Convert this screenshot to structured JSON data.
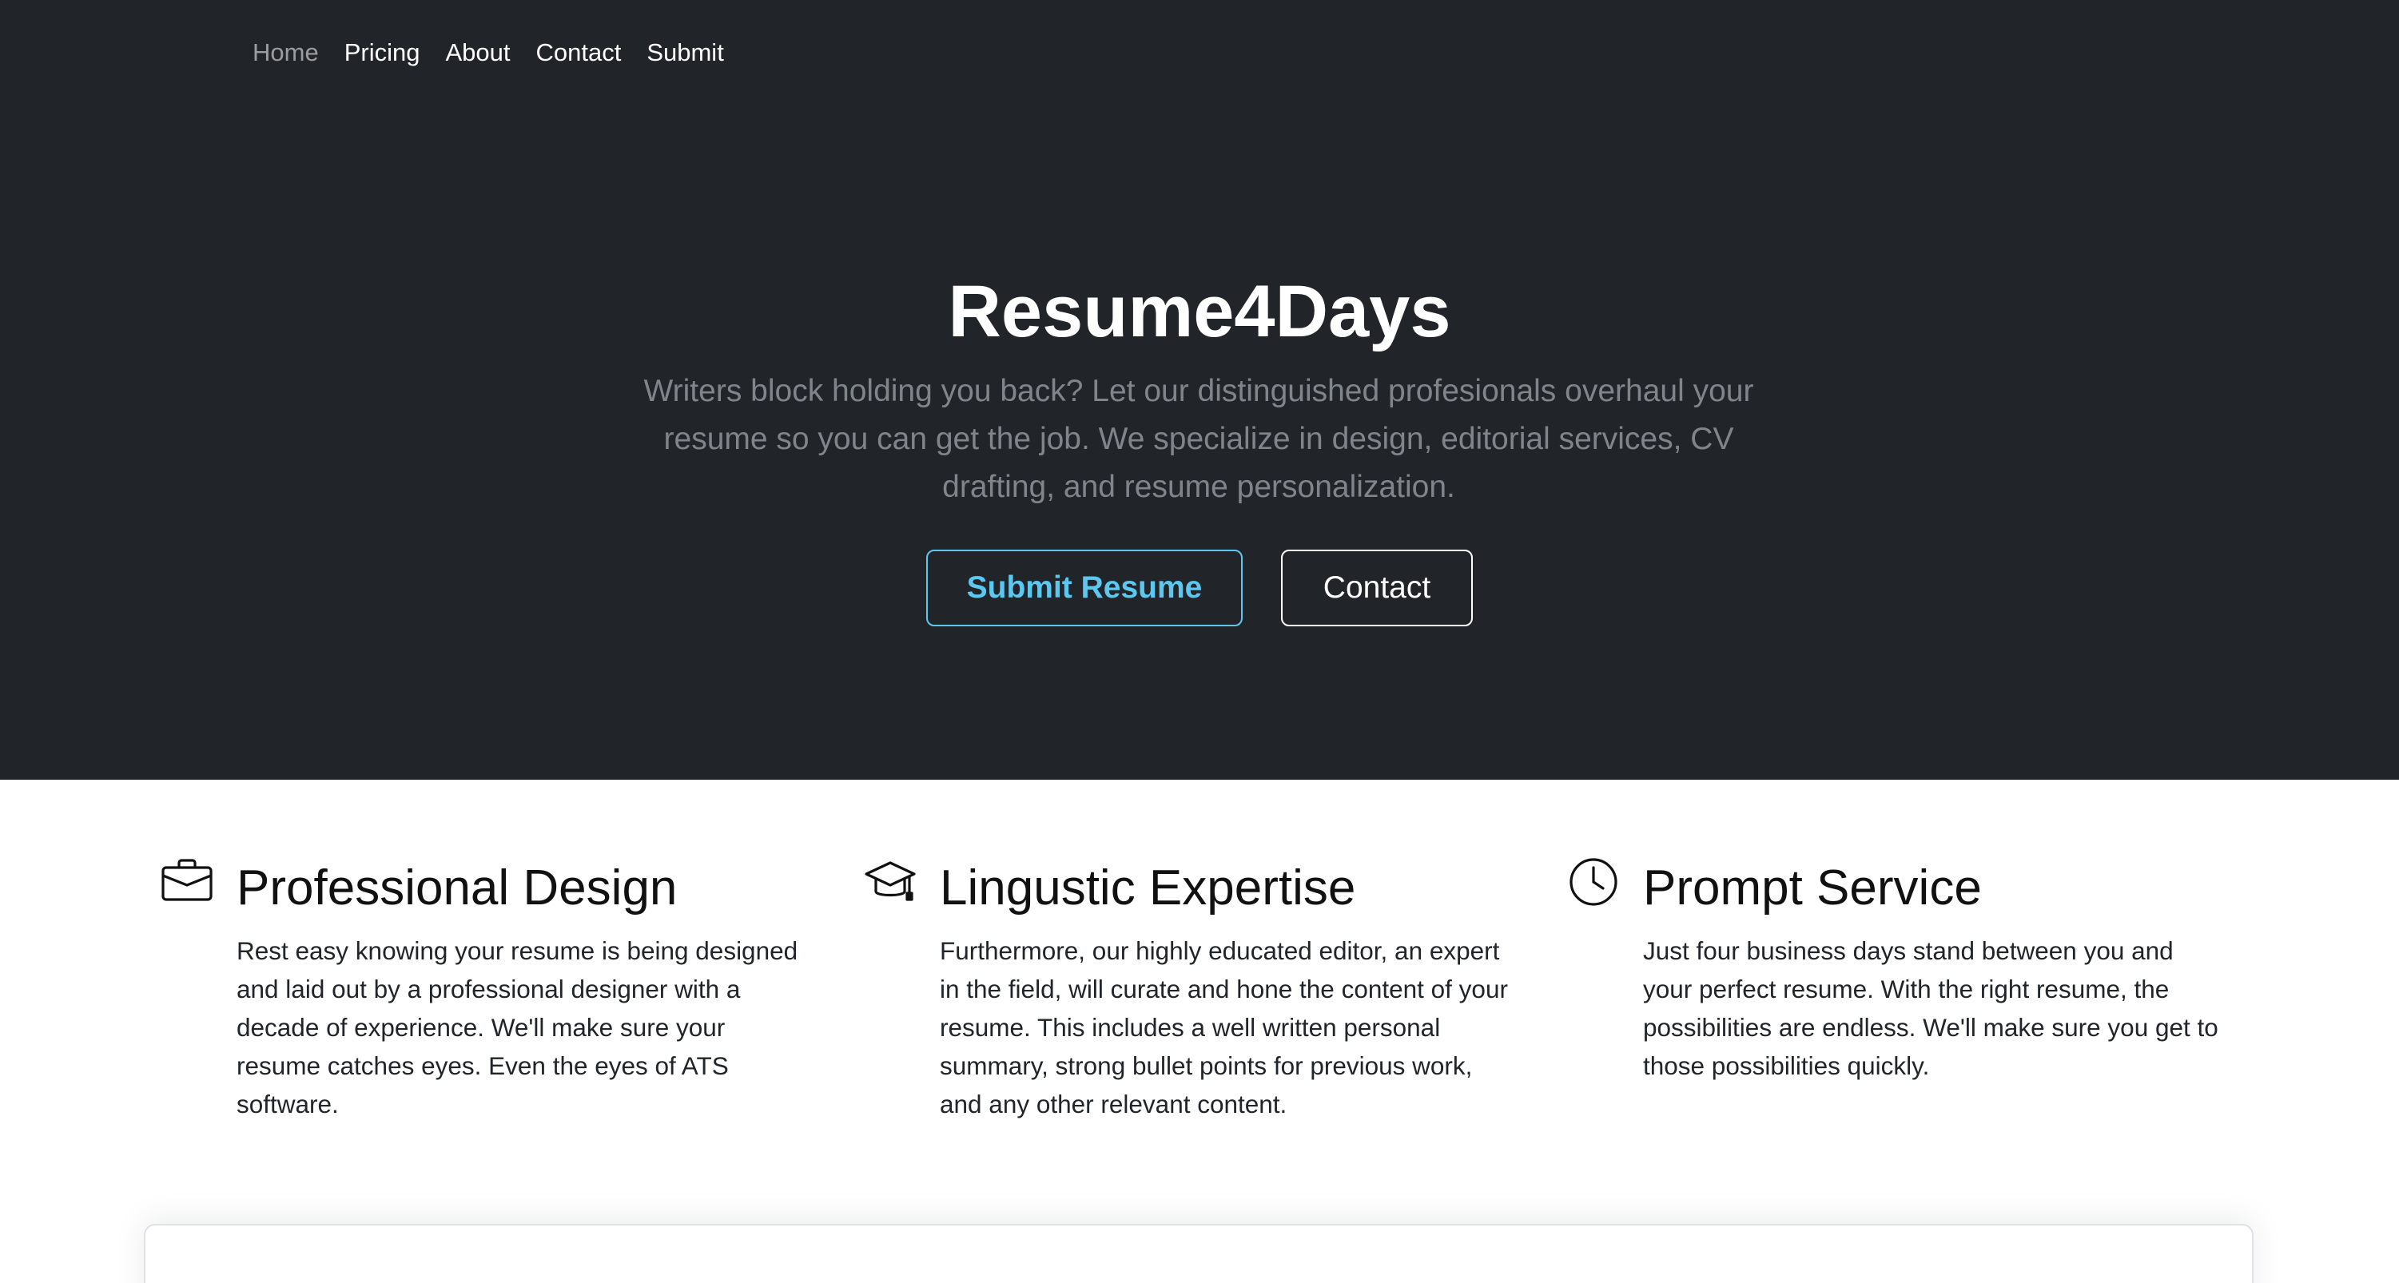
{
  "nav": {
    "items": [
      {
        "label": "Home",
        "active": true
      },
      {
        "label": "Pricing",
        "active": false
      },
      {
        "label": "About",
        "active": false
      },
      {
        "label": "Contact",
        "active": false
      },
      {
        "label": "Submit",
        "active": false
      }
    ]
  },
  "hero": {
    "title": "Resume4Days",
    "lead": "Writers block holding you back? Let our distinguished profesionals overhaul your resume so you can get the job. We specialize in design, editorial services, CV drafting, and resume personalization.",
    "primary_button": "Submit Resume",
    "secondary_button": "Contact"
  },
  "features": [
    {
      "icon": "briefcase-icon",
      "title": "Professional Design",
      "text": "Rest easy knowing your resume is being designed and laid out by a professional designer with a decade of experience. We'll make sure your resume catches eyes. Even the eyes of ATS software."
    },
    {
      "icon": "mortarboard-icon",
      "title": "Lingustic Expertise",
      "text": "Furthermore, our highly educated editor, an expert in the field, will curate and hone the content of your resume. This includes a well written personal summary, strong bullet points for previous work, and any other relevant content."
    },
    {
      "icon": "clock-icon",
      "title": "Prompt Service",
      "text": "Just four business days stand between you and your perfect resume. With the right resume, the possibilities are endless. We'll make sure you get to those possibilities quickly."
    }
  ],
  "colors": {
    "hero_bg": "#212529",
    "accent": "#5cc8ef",
    "lead_text": "#7f858b"
  }
}
